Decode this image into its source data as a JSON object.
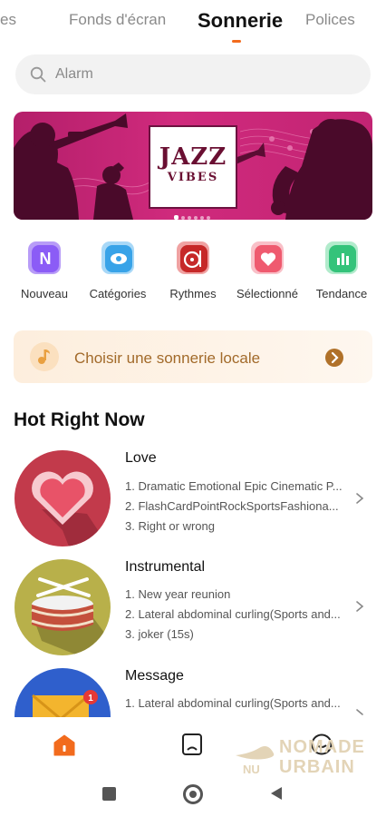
{
  "tabs": [
    {
      "label": "es"
    },
    {
      "label": "Fonds d'écran"
    },
    {
      "label": "Sonnerie"
    },
    {
      "label": "Polices"
    }
  ],
  "active_tab": "Sonnerie",
  "accent_color": "#f26b1d",
  "search": {
    "placeholder": "Alarm",
    "icon": "search-icon"
  },
  "banner": {
    "line1": "JAZZ",
    "line2": "VIBES",
    "page_count": 6,
    "current_page": 1
  },
  "categories": [
    {
      "label": "Nouveau",
      "icon": "new-icon",
      "color": "#8b5cf6",
      "glyph": "N"
    },
    {
      "label": "Catégories",
      "icon": "eye-icon",
      "color": "#38a3e8"
    },
    {
      "label": "Rythmes",
      "icon": "music-disc-icon",
      "color": "#c62828"
    },
    {
      "label": "Sélectionné",
      "icon": "heart-icon",
      "color": "#ef5a6f"
    },
    {
      "label": "Tendance",
      "icon": "chart-icon",
      "color": "#34c37a"
    }
  ],
  "local": {
    "label": "Choisir une sonnerie locale"
  },
  "section_title": "Hot Right Now",
  "playlists": [
    {
      "title": "Love",
      "items": [
        "1. Dramatic Emotional Epic Cinematic P...",
        "2. FlashCardPointRockSportsFashiona...",
        "3. Right or wrong"
      ]
    },
    {
      "title": "Instrumental",
      "items": [
        "1. New year reunion",
        "2. Lateral abdominal curling(Sports and...",
        "3. joker (15s)"
      ]
    },
    {
      "title": "Message",
      "items": [
        "1. Lateral abdominal curling(Sports and..."
      ],
      "badge": "1"
    }
  ],
  "watermark": {
    "line1": "NOMADE",
    "line2": "URBAIN",
    "small": "NU"
  }
}
